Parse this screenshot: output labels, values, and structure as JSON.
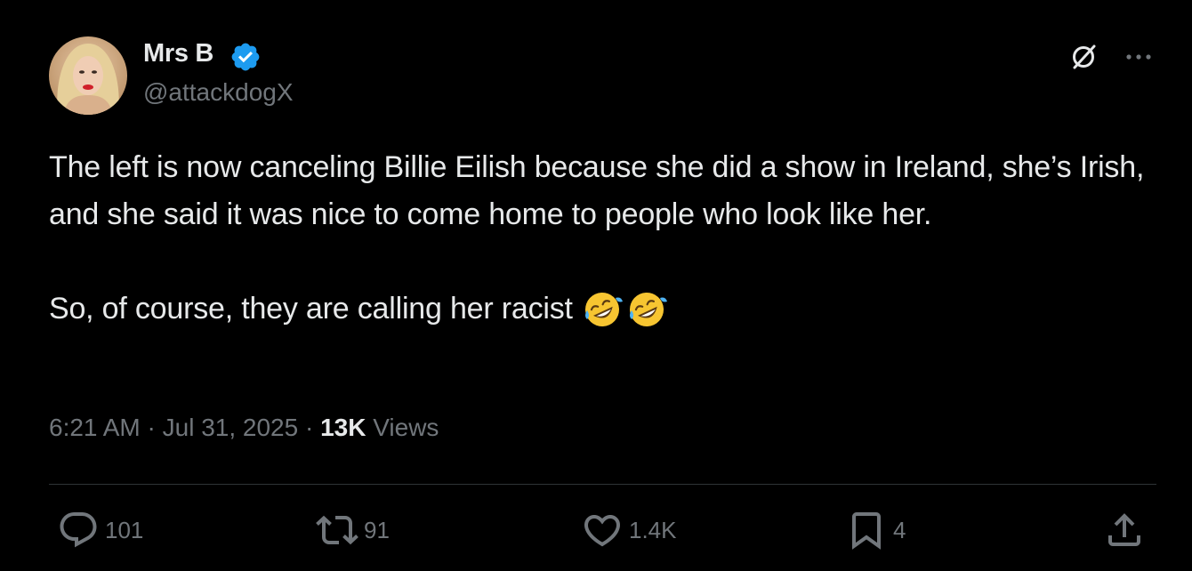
{
  "author": {
    "display_name": "Mrs B",
    "handle": "@attackdogX",
    "verified": true,
    "verified_color": "#1d9bf0"
  },
  "tweet": {
    "paragraph1": "The left is now canceling Billie Eilish because she did a show in Ireland, she’s Irish, and she said it was nice to come home to people who look like her.",
    "paragraph2": "So, of course, they are calling her racist",
    "emojis": [
      "rolling-on-floor-laughing-emoji",
      "rolling-on-floor-laughing-emoji"
    ]
  },
  "meta": {
    "time": "6:21 AM",
    "separator": " · ",
    "date": "Jul 31, 2025",
    "views_count": "13K",
    "views_label": " Views"
  },
  "actions": {
    "reply_count": "101",
    "retweet_count": "91",
    "like_count": "1.4K",
    "bookmark_count": "4"
  },
  "icons": {
    "header_right": [
      "grok-icon",
      "more-icon"
    ],
    "actions": [
      "reply-icon",
      "retweet-icon",
      "like-icon",
      "bookmark-icon",
      "share-icon"
    ]
  },
  "colors": {
    "background": "#000000",
    "text": "#e7e9ea",
    "secondary": "#71767b",
    "divider": "#2f3336",
    "accent": "#1d9bf0"
  }
}
